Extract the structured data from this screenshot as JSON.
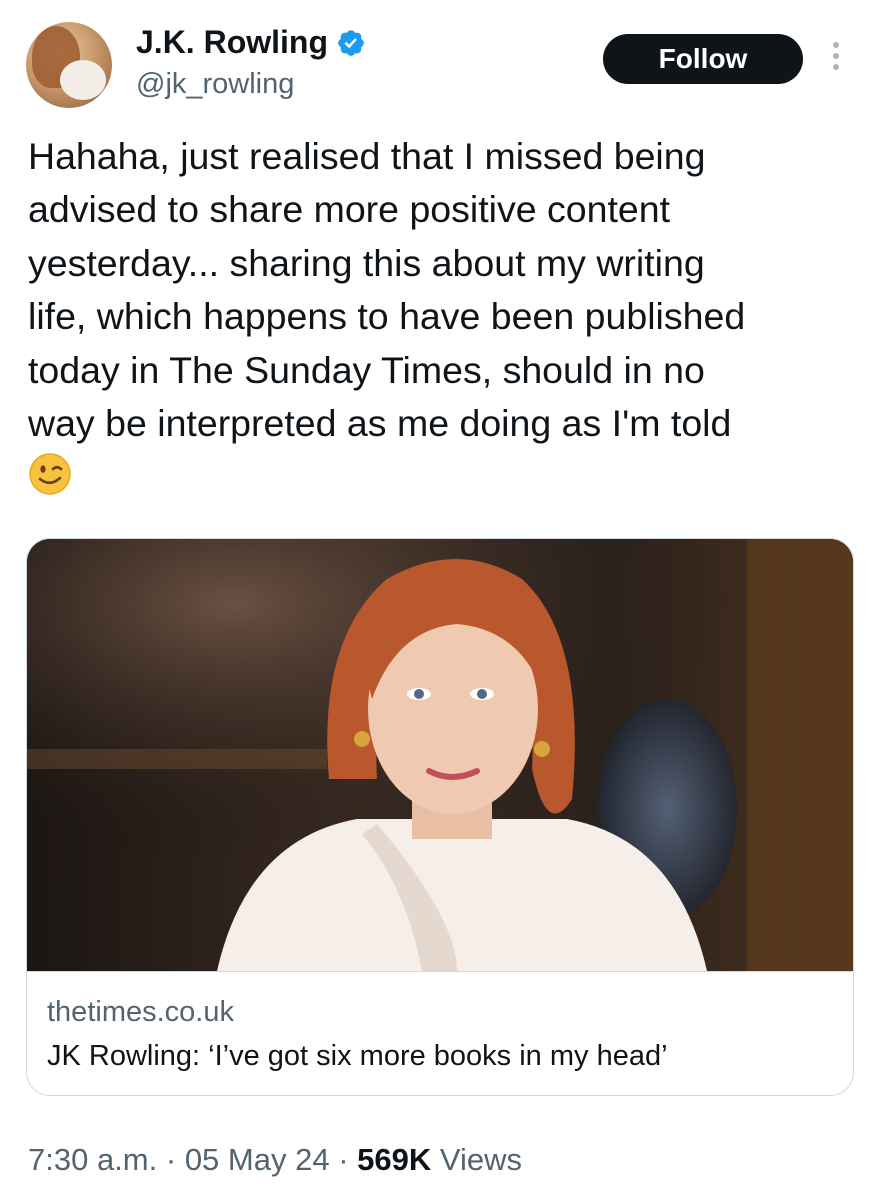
{
  "author": {
    "name": "J.K. Rowling",
    "handle": "@jk_rowling",
    "verified": true,
    "avatar_icon": "profile-photo-with-dog"
  },
  "actions": {
    "follow_label": "Follow",
    "more_icon": "more-options-icon"
  },
  "tweet": {
    "text": "Hahaha, just realised that I missed being\nadvised to share more positive content\nyesterday... sharing this about my writing\nlife, which happens to have been published\ntoday in The Sunday Times, should in no\nway be interpreted as me doing as I'm told",
    "emoji": "😉",
    "emoji_name": "winking-face"
  },
  "link_card": {
    "image_subject": "photo-portrait",
    "domain": "thetimes.co.uk",
    "title": "JK Rowling: ‘I’ve got six more books in my head’"
  },
  "meta": {
    "time": "7:30 a.m.",
    "separator": " · ",
    "date": "05 May 24",
    "views_count": "569K",
    "views_label": " Views"
  },
  "colors": {
    "text_primary": "#0f1419",
    "text_secondary": "#536471",
    "border": "#cfd9de",
    "verified_blue": "#1d9bf0",
    "follow_bg": "#0f1419"
  }
}
